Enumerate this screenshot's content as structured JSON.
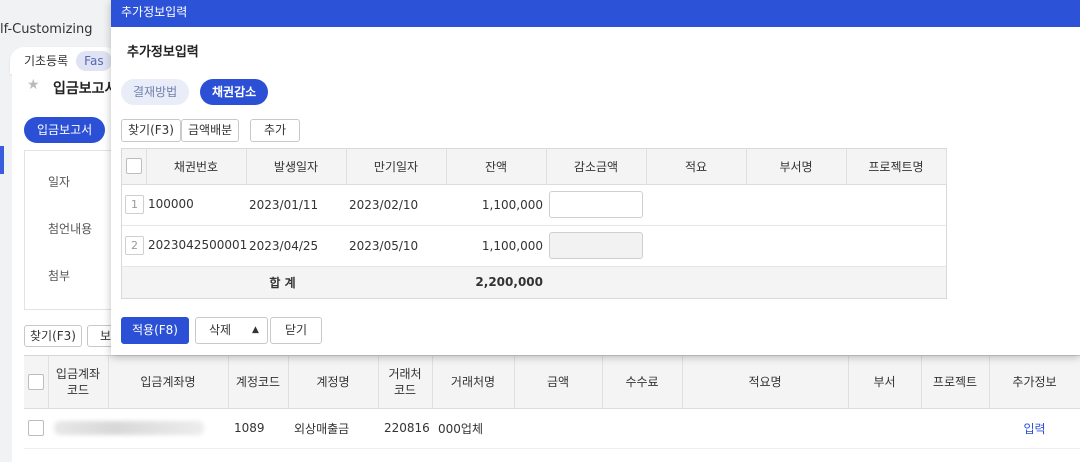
{
  "background": {
    "app_title": "lf-Customizing",
    "tabs": [
      "기초등록",
      "Fas"
    ],
    "page_title": "입금보고서",
    "page_tab": "입금보고서",
    "form_labels": [
      "일자",
      "첨언내용",
      "첨부"
    ],
    "find_button": "찾기(F3)",
    "second_button": "보",
    "grid_headers": [
      "입금계좌\n코드",
      "입금계좌명",
      "계정코드",
      "계정명",
      "거래처\n코드",
      "거래처명",
      "금액",
      "수수료",
      "적요명",
      "부서",
      "프로젝트",
      "추가정보"
    ],
    "grid_row": {
      "account_code": "1089",
      "account_name": "외상매출금",
      "client_code": "220816",
      "client_name": "000업체",
      "extra_info_link": "입력"
    }
  },
  "modal": {
    "header": "추가정보입력",
    "title": "추가정보입력",
    "tabs": {
      "payment": "결재방법",
      "bond": "채권감소"
    },
    "toolbar": {
      "find": "찾기(F3)",
      "distribute": "금액배분",
      "add": "추가"
    },
    "columns": [
      "채권번호",
      "발생일자",
      "만기일자",
      "잔액",
      "감소금액",
      "적요",
      "부서명",
      "프로젝트명"
    ],
    "rows": [
      {
        "no": "1",
        "bond_no": "100000",
        "issue_date": "2023/01/11",
        "due_date": "2023/02/10",
        "balance": "1,100,000"
      },
      {
        "no": "2",
        "bond_no": "2023042500001",
        "issue_date": "2023/04/25",
        "due_date": "2023/05/10",
        "balance": "1,100,000"
      }
    ],
    "total": {
      "label": "합 계",
      "balance": "2,200,000"
    },
    "footer": {
      "apply": "적용(F8)",
      "delete": "삭제",
      "close": "닫기"
    }
  },
  "colors": {
    "primary": "#2b50d6",
    "header": "#2c52d8"
  }
}
